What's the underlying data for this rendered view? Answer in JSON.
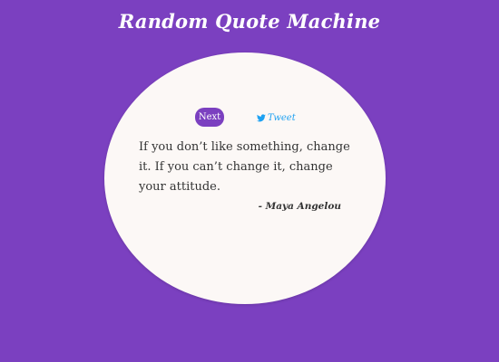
{
  "app": {
    "title": "Random Quote Machine"
  },
  "controls": {
    "next_label": "Next",
    "tweet_label": "Tweet",
    "tweet_icon": "twitter-bird-icon"
  },
  "quote": {
    "text": "If you don’t like something, change it. If you can’t change it, change your attitude.",
    "author": "- Maya Angelou"
  },
  "colors": {
    "background": "#7b40c0",
    "card": "#fcf8f6",
    "tweet": "#1da1f2",
    "text": "#333333"
  }
}
